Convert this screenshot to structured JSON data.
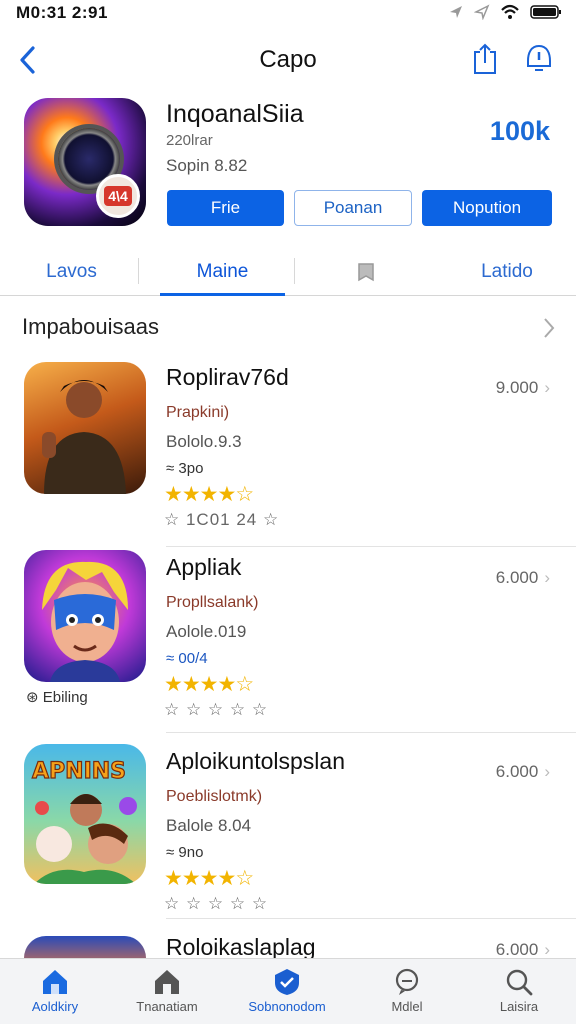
{
  "status": {
    "time": "M0:31  2:91"
  },
  "nav": {
    "title": "Capo"
  },
  "hero": {
    "name": "InqoanalSiia",
    "sub1": "220lrar",
    "sub2": "Sopin 8.82",
    "count": "100k",
    "buttons": [
      "Frie",
      "Poanan",
      "Nopution"
    ]
  },
  "tabs": [
    "Lavos",
    "Maine",
    "Latido"
  ],
  "section": {
    "title": "Impabouisaas"
  },
  "apps": [
    {
      "title": "Roplirav76d",
      "dev": "Prapkini)",
      "version": "Bololo.9.3",
      "size": "≈ 3po",
      "rating_text": "☆ 1C01 24 ☆",
      "price": "9.000",
      "stars": 4.5
    },
    {
      "title": "Appliak",
      "dev": "Propllsalank)",
      "version": "Aolole.019",
      "size": "≈ 00/4",
      "rating_text": "☆ ☆ ☆ ☆ ☆",
      "price": "6.000",
      "stars": 4.5,
      "caption": "Ebiling"
    },
    {
      "title": "Aploikuntolspslan",
      "dev": "Poeblislotmk)",
      "version": "Balole 8.04",
      "size": "≈ 9no",
      "rating_text": "☆ ☆ ☆ ☆ ☆",
      "price": "6.000",
      "stars": 4.5
    },
    {
      "title": "Roloikaslaplag",
      "price": "6.000"
    }
  ],
  "tabbar": [
    "Aoldkiry",
    "Tnanatiam",
    "Sobnonodom",
    "Mdlel",
    "Laisira"
  ]
}
